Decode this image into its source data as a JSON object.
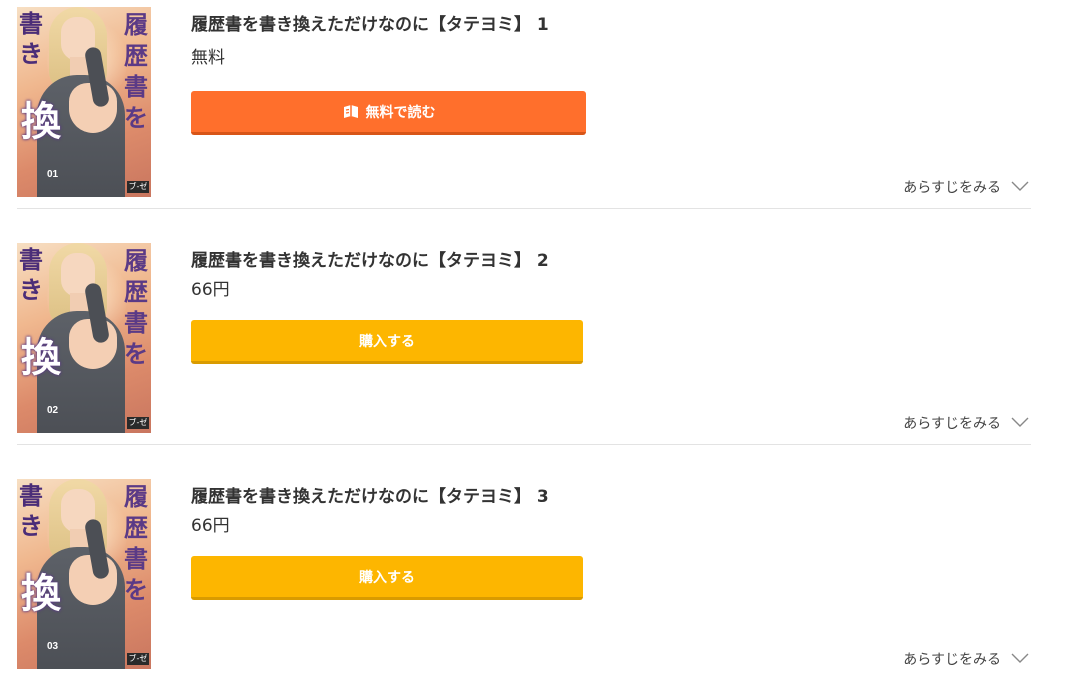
{
  "items": [
    {
      "title": "履歴書を書き換えただけなのに【タテヨミ】 1",
      "price": "無料",
      "button_label": "無料で読む",
      "synopsis_label": "あらすじをみる",
      "cover": {
        "right_title": "履歴書を",
        "left_title": "書き",
        "big_char": "換",
        "volume": "01",
        "publisher": "ブ-ゼ"
      }
    },
    {
      "title": "履歴書を書き換えただけなのに【タテヨミ】 2",
      "price": "66円",
      "button_label": "購入する",
      "synopsis_label": "あらすじをみる",
      "cover": {
        "right_title": "履歴書を",
        "left_title": "書き",
        "big_char": "換",
        "volume": "02",
        "publisher": "ブ-ゼ"
      }
    },
    {
      "title": "履歴書を書き換えただけなのに【タテヨミ】 3",
      "price": "66円",
      "button_label": "購入する",
      "synopsis_label": "あらすじをみる",
      "cover": {
        "right_title": "履歴書を",
        "left_title": "書き",
        "big_char": "換",
        "volume": "03",
        "publisher": "ブ-ゼ"
      }
    }
  ],
  "colors": {
    "free_button": "#ff6f2c",
    "buy_button": "#fdb600",
    "divider": "#e3e3e3",
    "text": "#333333"
  },
  "icons": {
    "free_button_icon": "open-book-icon",
    "synopsis_icon": "chevron-down-icon"
  }
}
